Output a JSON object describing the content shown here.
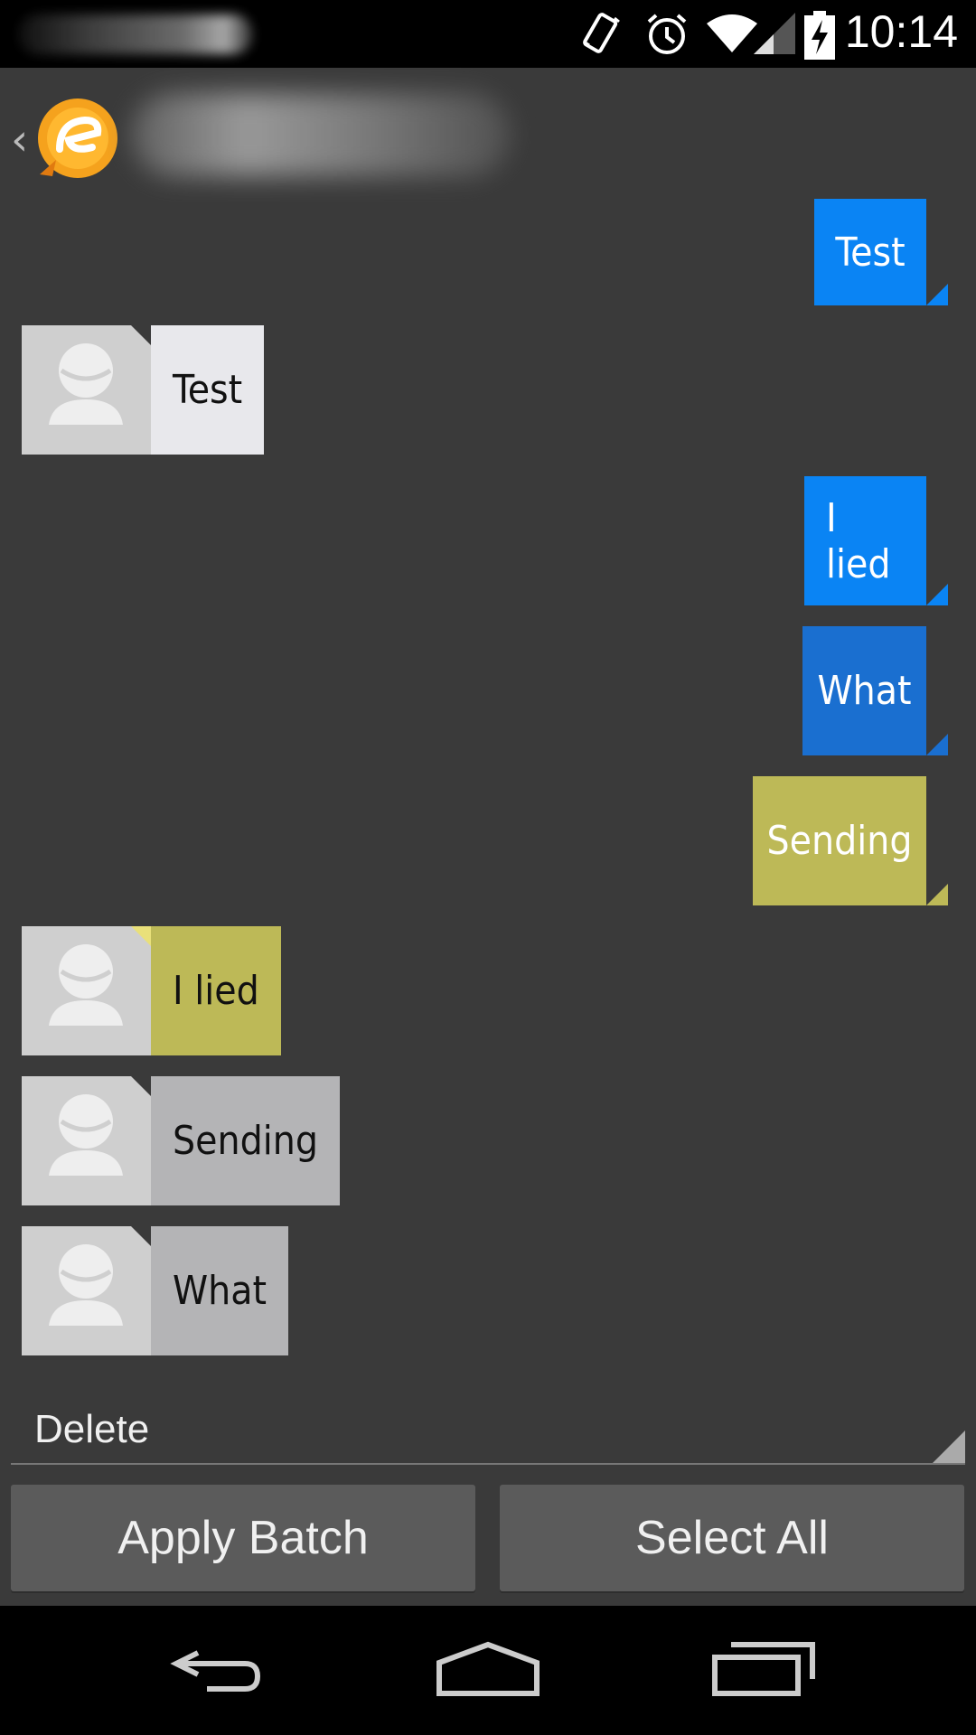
{
  "status_bar": {
    "time": "10:14"
  },
  "messages_out": [
    {
      "text": "Test",
      "color": "#0a84f4"
    },
    {
      "text": "I lied",
      "color": "#0a84f4"
    },
    {
      "text": "What",
      "color": "#1a6fd0"
    },
    {
      "text": "Sending",
      "color": "#bdb957"
    }
  ],
  "messages_in": [
    {
      "text": "Test",
      "color": "#e8e8ec"
    },
    {
      "text": "I lied",
      "color": "#bdb957"
    },
    {
      "text": "Sending",
      "color": "#b4b4b6"
    },
    {
      "text": "What",
      "color": "#b4b4b6"
    }
  ],
  "batch": {
    "action_selected": "Delete",
    "apply_label": "Apply Batch",
    "select_all_label": "Select All"
  },
  "icons": {
    "back": "back-icon",
    "home": "home-icon",
    "recents": "recents-icon"
  }
}
